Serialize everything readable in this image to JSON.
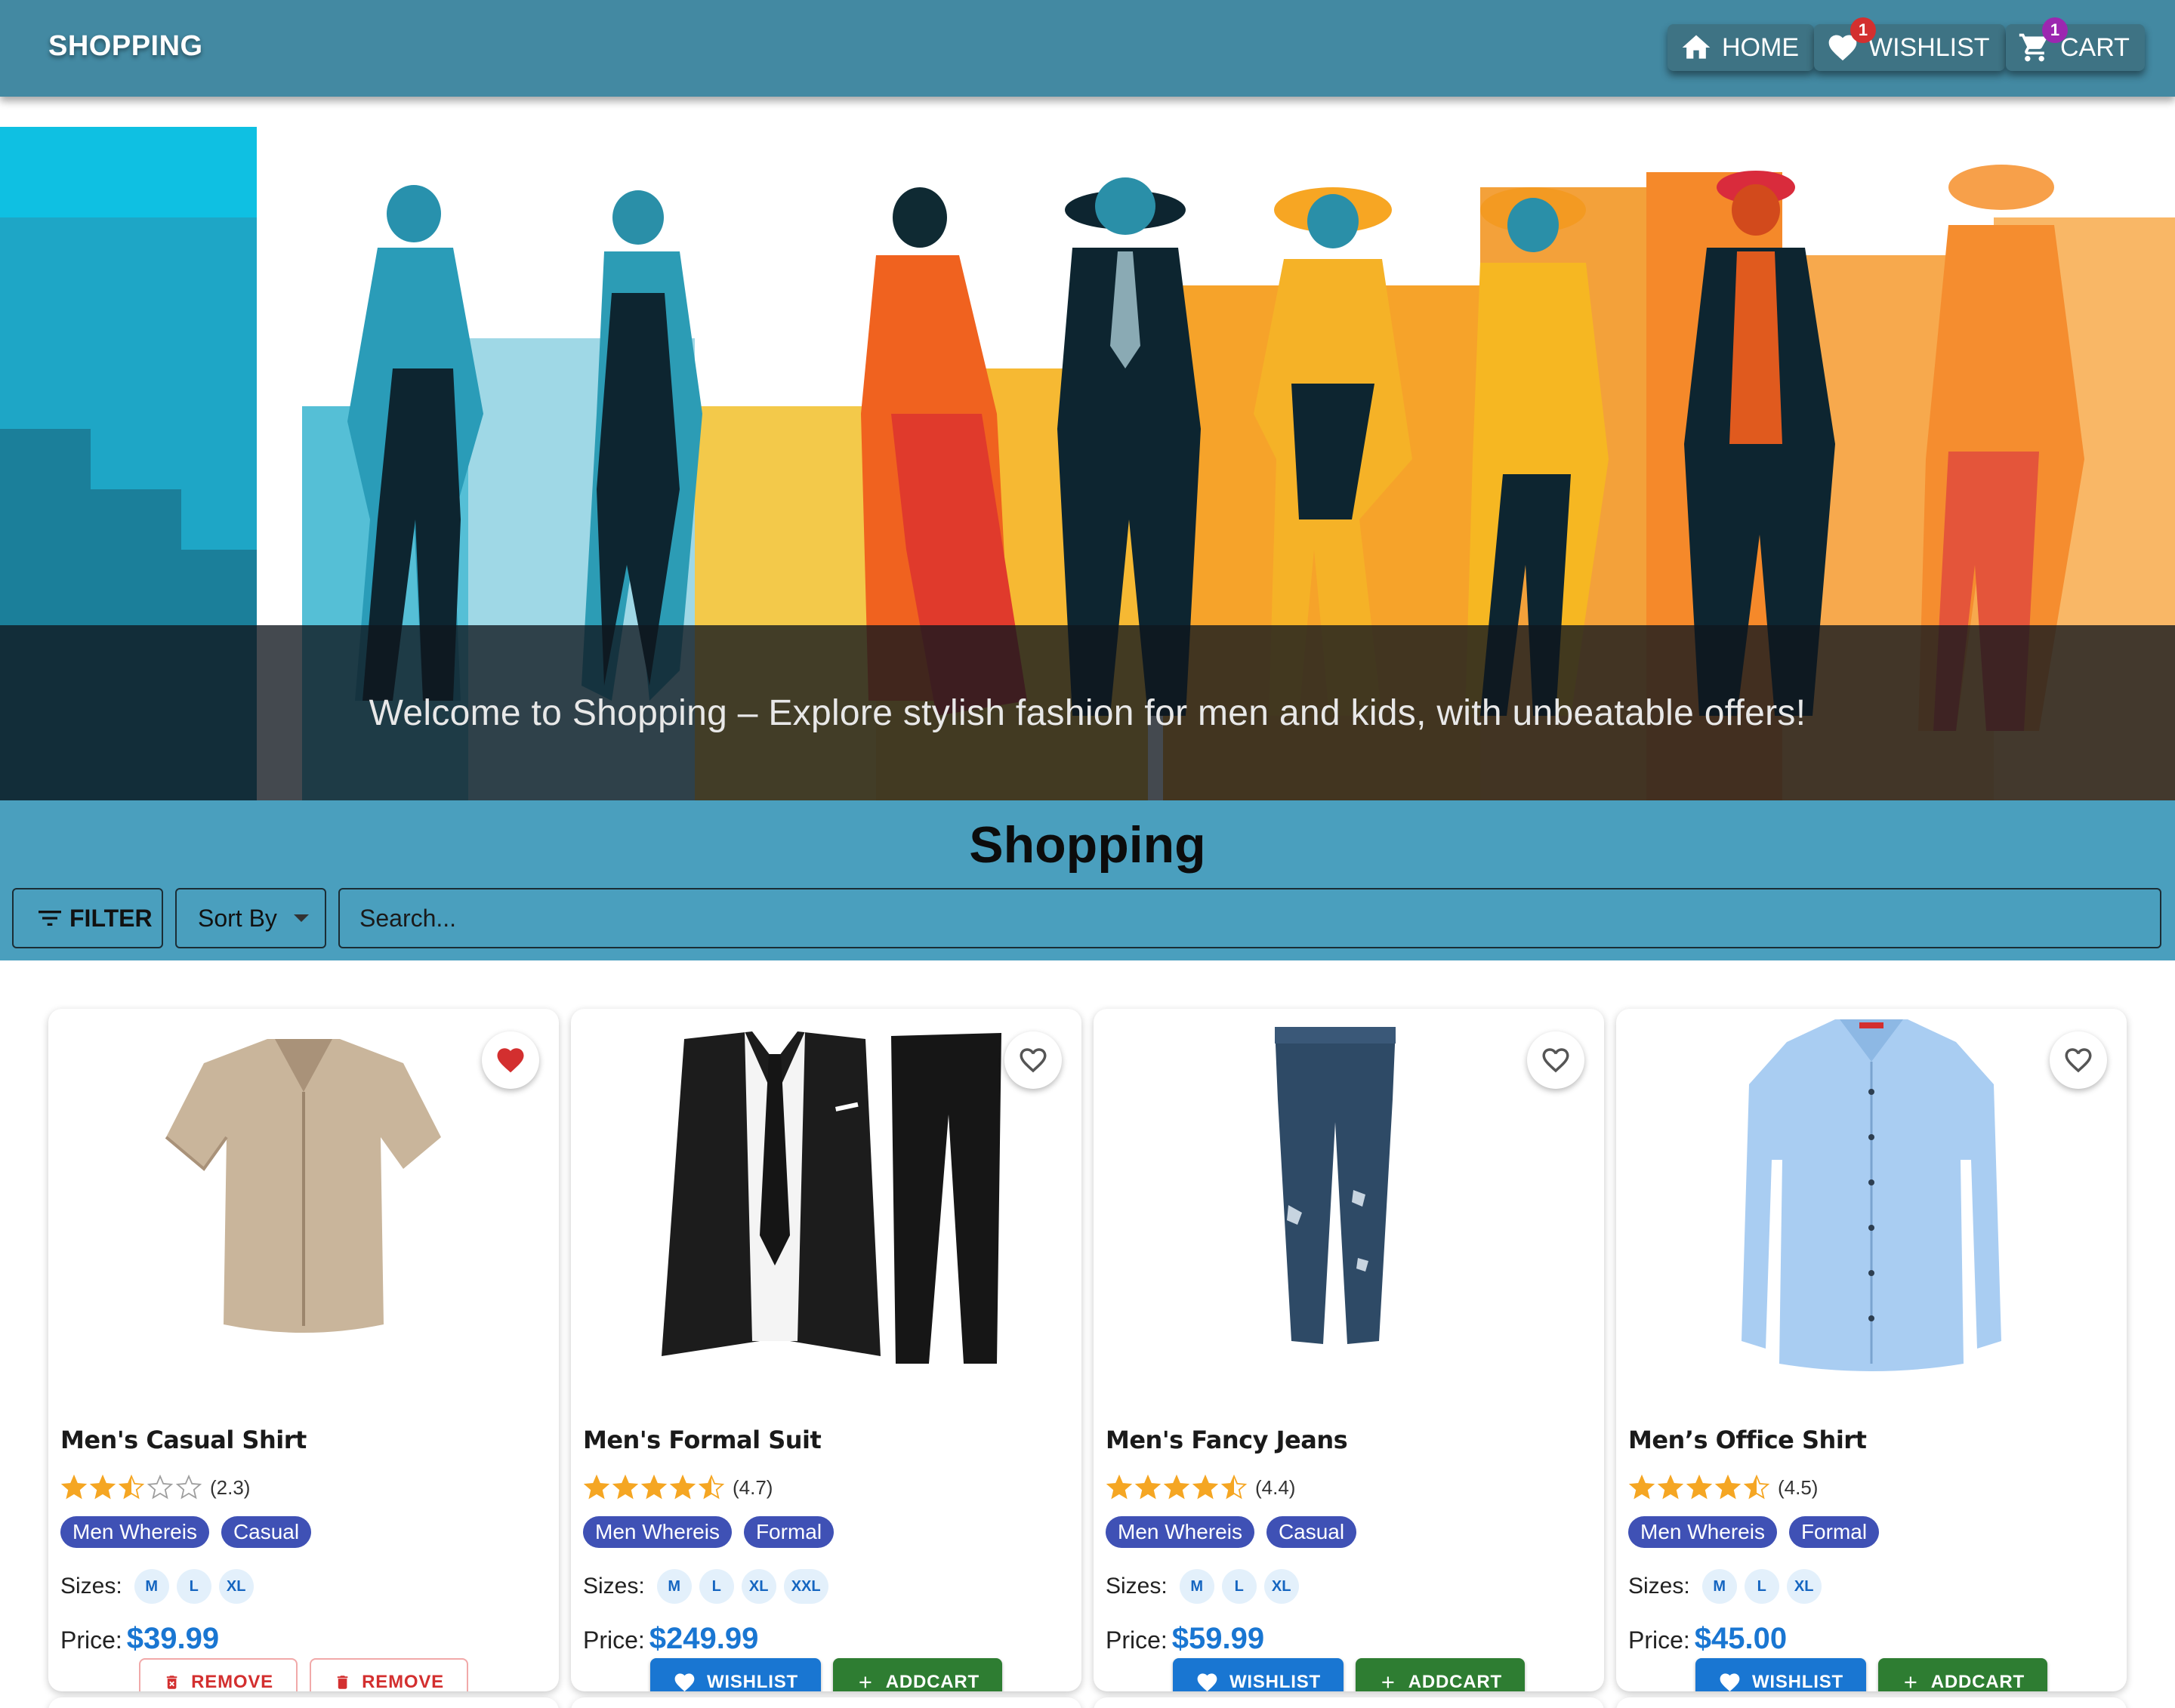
{
  "appbar": {
    "brand": "SHOPPING",
    "nav": {
      "home": "HOME",
      "wishlist": "WISHLIST",
      "wishlist_count": "1",
      "cart": "CART",
      "cart_count": "1"
    }
  },
  "hero": {
    "tagline": "Welcome to Shopping – Explore stylish fashion for men and kids, with unbeatable offers!"
  },
  "page": {
    "title": "Shopping",
    "filter_label": "FILTER",
    "sort_label": "Sort By",
    "search_placeholder": "Search..."
  },
  "colors": {
    "appbar": "#4389a2",
    "band": "#4a9fbe",
    "chip": "#3f51b5",
    "price": "#1976d2",
    "wishlist_button": "#1976d2",
    "addcart_button": "#2e7d32",
    "remove_text": "#d32f2f",
    "star": "#f5a623"
  },
  "products": [
    {
      "name": "Men's Casual Shirt",
      "rating": 2.3,
      "rating_text": "(2.3)",
      "tags": [
        "Men Whereis",
        "Casual"
      ],
      "sizes_label": "Sizes:",
      "sizes": [
        "M",
        "L",
        "XL"
      ],
      "price_label": "Price:",
      "price": "$39.99",
      "favorited": true,
      "actions": [
        "REMOVE",
        "REMOVE"
      ]
    },
    {
      "name": "Men's Formal Suit",
      "rating": 4.7,
      "rating_text": "(4.7)",
      "tags": [
        "Men Whereis",
        "Formal"
      ],
      "sizes_label": "Sizes:",
      "sizes": [
        "M",
        "L",
        "XL",
        "XXL"
      ],
      "price_label": "Price:",
      "price": "$249.99",
      "favorited": false,
      "actions": [
        "WISHLIST",
        "ADDCART"
      ]
    },
    {
      "name": "Men's Fancy Jeans",
      "rating": 4.4,
      "rating_text": "(4.4)",
      "tags": [
        "Men Whereis",
        "Casual"
      ],
      "sizes_label": "Sizes:",
      "sizes": [
        "M",
        "L",
        "XL"
      ],
      "price_label": "Price:",
      "price": "$59.99",
      "favorited": false,
      "actions": [
        "WISHLIST",
        "ADDCART"
      ]
    },
    {
      "name": "Men’s Office Shirt",
      "rating": 4.5,
      "rating_text": "(4.5)",
      "tags": [
        "Men Whereis",
        "Formal"
      ],
      "sizes_label": "Sizes:",
      "sizes": [
        "M",
        "L",
        "XL"
      ],
      "price_label": "Price:",
      "price": "$45.00",
      "favorited": false,
      "actions": [
        "WISHLIST",
        "ADDCART"
      ]
    }
  ]
}
